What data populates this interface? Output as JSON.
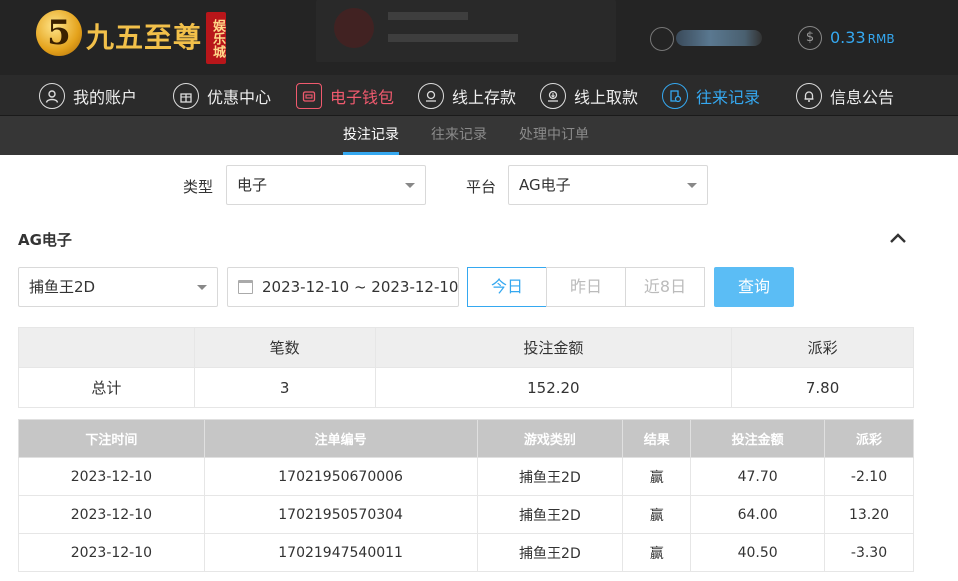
{
  "header": {
    "logo_text": "九五至尊",
    "logo_badge": "娱乐城",
    "balance": "0.33",
    "currency": "RMB"
  },
  "nav": [
    {
      "label": "我的账户",
      "icon": "user-icon"
    },
    {
      "label": "优惠中心",
      "icon": "gift-icon"
    },
    {
      "label": "电子钱包",
      "icon": "wallet-icon"
    },
    {
      "label": "线上存款",
      "icon": "deposit-icon"
    },
    {
      "label": "线上取款",
      "icon": "withdraw-icon"
    },
    {
      "label": "往来记录",
      "icon": "record-icon"
    },
    {
      "label": "信息公告",
      "icon": "bell-icon"
    }
  ],
  "subnav": [
    "投注记录",
    "往来记录",
    "处理中订单"
  ],
  "filters": {
    "type_label": "类型",
    "type_value": "电子",
    "platform_label": "平台",
    "platform_value": "AG电子"
  },
  "section": {
    "title": "AG电子",
    "game": "捕鱼王2D",
    "date_range": "2023-12-10 ~ 2023-12-10",
    "quick": [
      "今日",
      "昨日",
      "近8日"
    ],
    "query": "查询"
  },
  "summary": {
    "headers": [
      "",
      "笔数",
      "投注金额",
      "派彩"
    ],
    "row": [
      "总计",
      "3",
      "152.20",
      "7.80"
    ]
  },
  "records": {
    "headers": [
      "下注时间",
      "注单编号",
      "游戏类别",
      "结果",
      "投注金额",
      "派彩"
    ],
    "rows": [
      [
        "2023-12-10",
        "17021950670006",
        "捕鱼王2D",
        "赢",
        "47.70",
        "-2.10"
      ],
      [
        "2023-12-10",
        "17021950570304",
        "捕鱼王2D",
        "赢",
        "64.00",
        "13.20"
      ],
      [
        "2023-12-10",
        "17021947540011",
        "捕鱼王2D",
        "赢",
        "40.50",
        "-3.30"
      ]
    ]
  },
  "colors": {
    "accent": "#35a8f0",
    "wallet": "#f05a6e",
    "negative": "#e02a2a"
  }
}
